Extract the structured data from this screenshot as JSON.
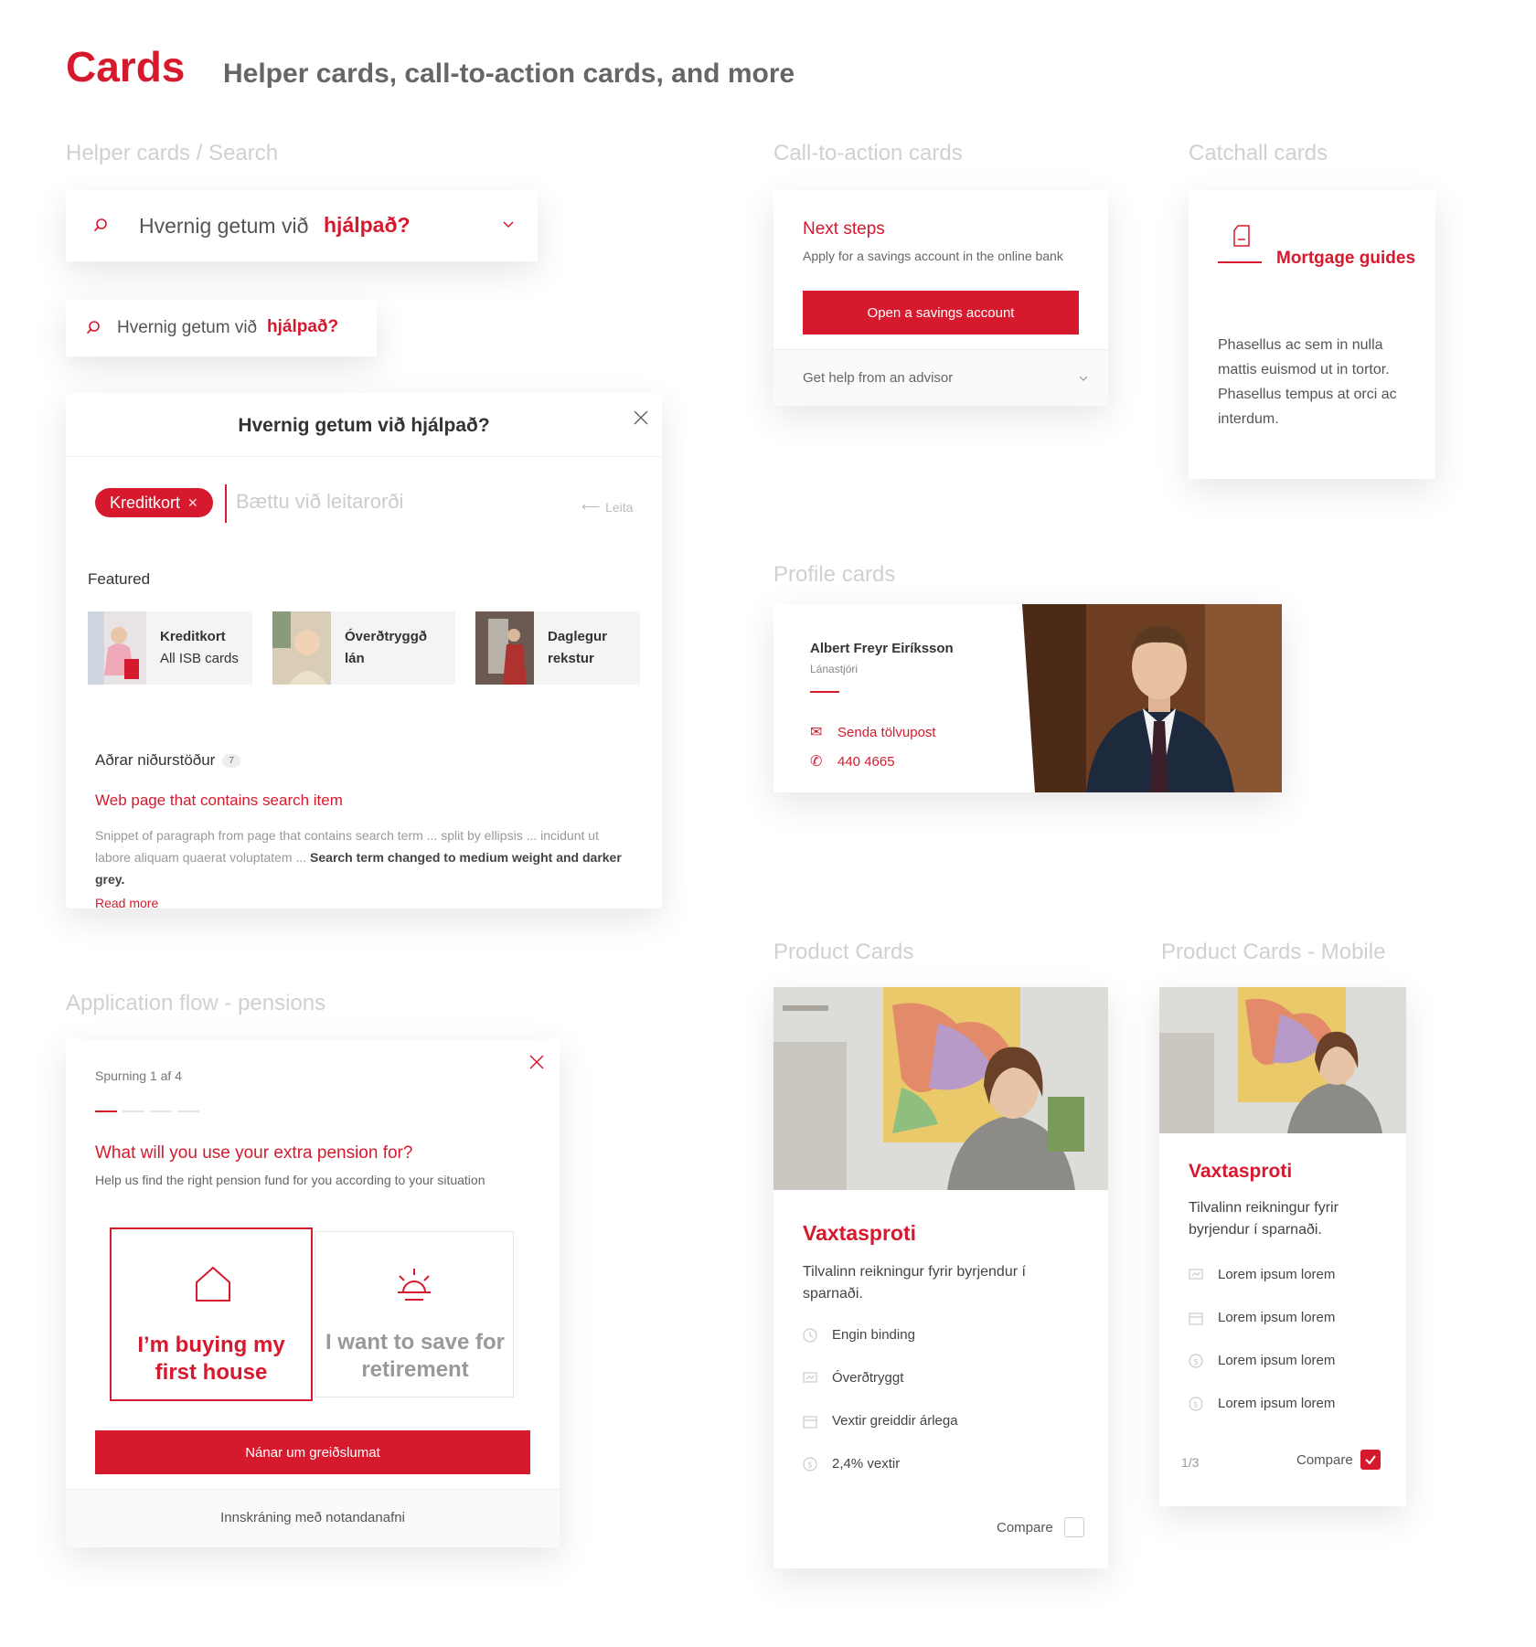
{
  "header": {
    "title": "Cards",
    "subtitle": "Helper cards, call-to-action cards, and more"
  },
  "sections": {
    "helper": "Helper cards / Search",
    "cta": "Call-to-action cards",
    "catchall": "Catchall cards",
    "profile": "Profile cards",
    "application": "Application flow - pensions",
    "product": "Product Cards",
    "product_mobile": "Product Cards - Mobile"
  },
  "search_large": {
    "prefix": "Hvernig getum við",
    "highlight": "hjálpað?"
  },
  "search_small": {
    "prefix": "Hvernig getum við",
    "highlight": "hjálpað?"
  },
  "search_modal": {
    "title": "Hvernig getum við hjálpað?",
    "chip": "Kreditkort",
    "placeholder": "Bættu við leitarorði",
    "search_hint": "Leita",
    "featured_label": "Featured",
    "featured": [
      {
        "title": "Kreditkort",
        "subtitle": "All ISB cards"
      },
      {
        "title": "Óverðtryggð",
        "subtitle": "lán"
      },
      {
        "title": "Daglegur",
        "subtitle": "rekstur"
      }
    ],
    "other_results_label": "Aðrar niðurstöður",
    "other_results_count": "7",
    "result_title": "Web page that contains search item",
    "result_snippet": "Snippet of paragraph from page that contains search term ... split by ellipsis ... incidunt ut labore aliquam quaerat voluptatem ...",
    "result_snippet_bold": "Search term changed to medium weight and darker grey.",
    "read_more": "Read more"
  },
  "cta_card": {
    "title": "Next steps",
    "description": "Apply for a savings account in the online bank",
    "button": "Open a savings account",
    "help": "Get help from an advisor"
  },
  "catchall_card": {
    "title": "Mortgage guides",
    "body": "Phasellus ac sem in nulla mattis euismod ut in tortor. Phasellus tempus at orci ac interdum."
  },
  "profile_card": {
    "name": "Albert Freyr Eiríksson",
    "role": "Lánastjóri",
    "email_label": "Senda tölvupost",
    "phone": "440 4665"
  },
  "application_card": {
    "step": "Spurning 1 af 4",
    "question": "What will you use your extra pension for?",
    "help": "Help us find the right pension fund for you according to your situation",
    "option1": "I’m buying my first house",
    "option2": "I want to save for retirement",
    "button": "Nánar um greiðslumat",
    "footer": "Innskráning með notandanafni"
  },
  "product_card": {
    "title": "Vaxtasproti",
    "description": "Tilvalinn reikningur fyrir byrjendur í sparnaði.",
    "features": [
      "Engin binding",
      "Óverðtryggt",
      "Vextir greiddir árlega",
      "2,4% vextir"
    ],
    "compare": "Compare"
  },
  "product_card_mobile": {
    "title": "Vaxtasproti",
    "description": "Tilvalinn reikningur fyrir byrjendur í sparnaði.",
    "features": [
      "Lorem ipsum lorem",
      "Lorem ipsum lorem",
      "Lorem ipsum lorem",
      "Lorem ipsum lorem"
    ],
    "pager": "1/3",
    "compare": "Compare"
  },
  "colors": {
    "accent": "#d7192d",
    "section_label": "#d0d0d0",
    "text": "#333333"
  }
}
